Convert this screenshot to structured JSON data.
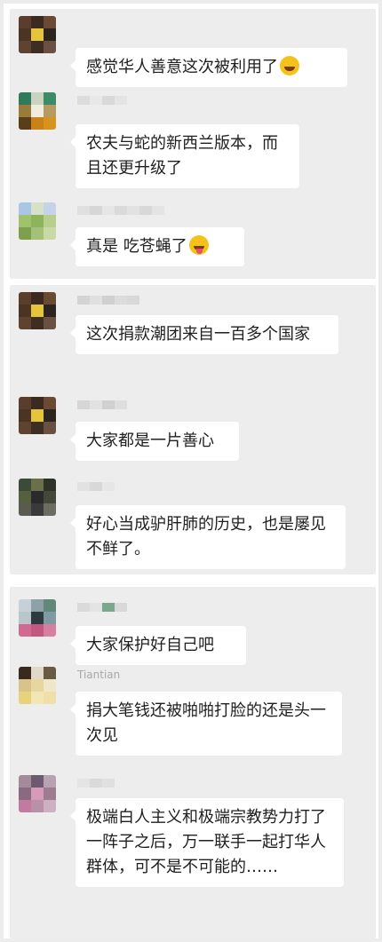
{
  "panels": [
    {
      "messages": [
        {
          "nick": "",
          "text": "感觉华人善意这次被利用了",
          "emoji": "laugh-cry-icon"
        },
        {
          "nick": "",
          "text": "农夫与蛇的新西兰版本，而且还更升级了",
          "emoji": ""
        },
        {
          "nick": "",
          "text": "真是 吃苍蝇了",
          "emoji": "tongue-out-icon"
        }
      ]
    },
    {
      "messages": [
        {
          "nick": "",
          "text": "这次捐款潮团来自一百多个国家",
          "emoji": ""
        },
        {
          "nick": "",
          "text": "大家都是一片善心",
          "emoji": ""
        },
        {
          "nick": "",
          "text": "好心当成驴肝肺的历史，也是屡见不鲜了。",
          "emoji": ""
        }
      ]
    },
    {
      "messages": [
        {
          "nick": "",
          "text": "大家保护好自己吧",
          "emoji": ""
        },
        {
          "nick": "Tiantian",
          "text": "捐大笔钱还被啪啪打脸的还是头一次见",
          "emoji": ""
        },
        {
          "nick": "",
          "text": "极端白人主义和极端宗教势力打了一阵子之后，万一联手一起打华人群体，可不是不可能的……",
          "emoji": ""
        }
      ]
    }
  ],
  "colors": {
    "chat_background": "#ededed",
    "bubble": "#ffffff",
    "text": "#1f1f1f",
    "nickname": "#a8a8a8"
  }
}
